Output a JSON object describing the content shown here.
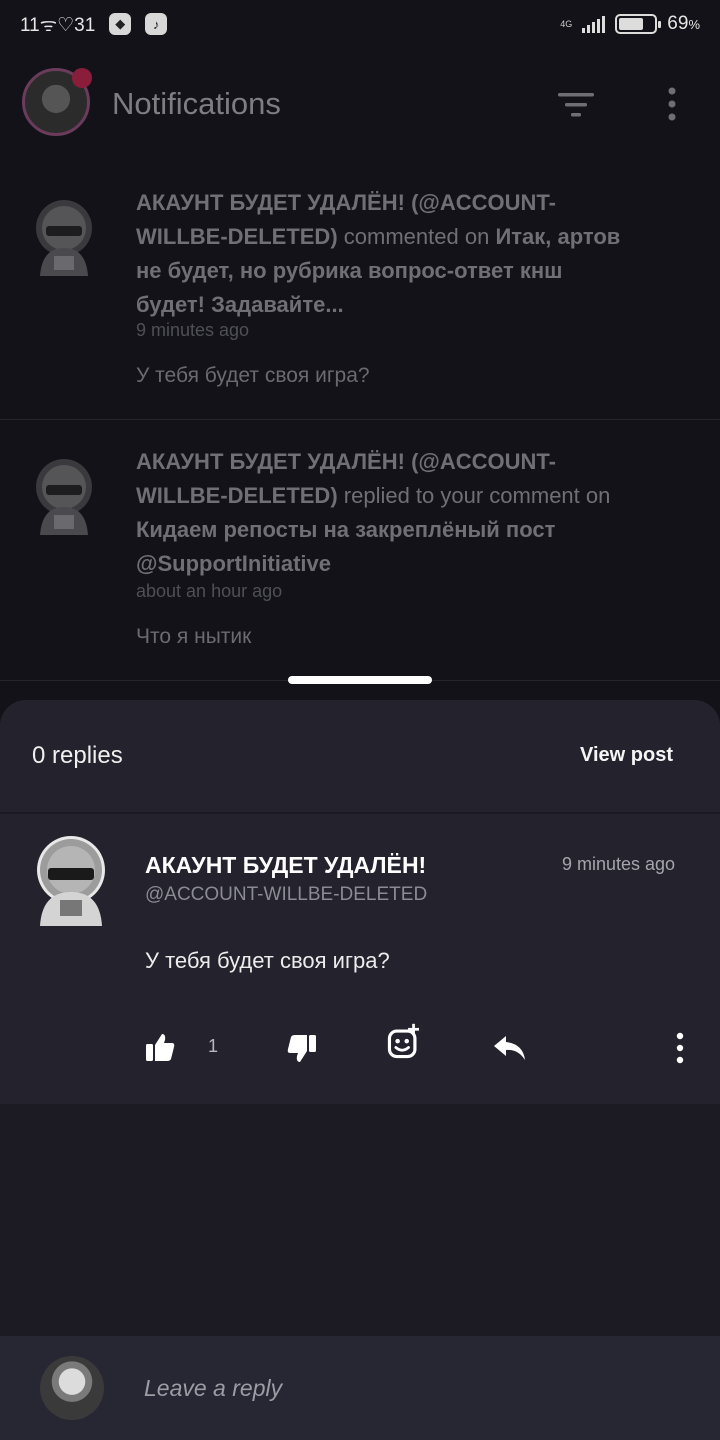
{
  "status_bar": {
    "time": "11",
    "notif_text": "31",
    "network": "4G",
    "battery_percent": "69",
    "battery_unit": "%"
  },
  "header": {
    "title": "Notifications",
    "icons": [
      "filter-icon",
      "more-vertical-icon"
    ]
  },
  "notifications": [
    {
      "author": "АКАУНТ БУДЕТ УДАЛЁН! (@ACCOUNT-WILLBE-DELETED)",
      "action": "commented on",
      "target": "Итак, артов не будет, но рубрика вопрос-ответ кнш будет! Задавайте...",
      "time": "9 minutes ago",
      "snippet": "У тебя будет своя игра?"
    },
    {
      "author": "АКАУНТ БУДЕТ УДАЛЁН! (@ACCOUNT-WILLBE-DELETED)",
      "action": "replied to your comment on",
      "target": "Кидаем репосты на закреплёный пост @SupportInitiative",
      "time": "about an hour ago",
      "snippet": "Что я нытик"
    }
  ],
  "sheet": {
    "replies_label": "0 replies",
    "view_post_label": "View post",
    "comment": {
      "name": "АКАУНТ БУДЕТ УДАЛЁН!",
      "handle": "@ACCOUNT-WILLBE-DELETED",
      "time": "9 minutes ago",
      "body": "У тебя будет своя игра?",
      "like_count": "1"
    },
    "reply_placeholder": "Leave a reply"
  },
  "colors": {
    "background": "#121218",
    "sheet": "#23222d",
    "notification_dot": "#8a1e3a"
  }
}
